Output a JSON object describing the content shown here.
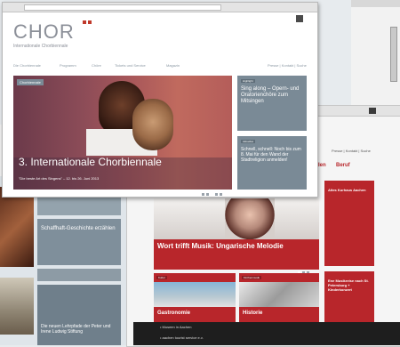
{
  "front_window": {
    "logo_text": "CHOR",
    "logo_subtitle": "Internationale Chorbiennale",
    "nav_items": [
      "Die Chorbiennale",
      "Programm",
      "Chöre",
      "Tickets und Service",
      "Magazin"
    ],
    "nav_right": "Presse | Kontakt | Suche",
    "hero_badge": "Chorbiennale",
    "hero_title": "3. Internationale Chorbiennale",
    "hero_subtitle": "\"Die beste Art des Singens\" – 12. bis 26. Juni 2013",
    "side_box_1": {
      "tag": "Highlight",
      "title": "Sing along – Opern- und Oratorienchöre zum Mitsingen"
    },
    "side_box_2": {
      "tag": "Aktuelles",
      "title": "Schnell, schnell: Noch bis zum 8. Mai für den Wand der Stadtreligion anmelden!"
    }
  },
  "right_window": {
    "top_links": "Presse | Kontakt | Suche",
    "nav_visible": [
      "den",
      "Beruf"
    ],
    "feature_title": "Wort trifft Musik: Ungarische Melodie",
    "tile_1_tag": "Kultur",
    "tile_1_title": "Gastronomie",
    "tile_2_tag": "Kirchenmusik",
    "tile_2_title": "Historie",
    "sidebar_box_1_title": "Altes Kurhaus Aachen",
    "sidebar_box_2_title": "Ene Musikreise nach St. Petersburg + Kinderkonzert"
  },
  "left_window": {
    "teaser_title": "Schaffhaft-Geschichte erzählen",
    "teaser_2_title": "Die neuen Lehrpfade der Peter und Irene Ludwig Stiftung"
  },
  "dark_bar": {
    "items": [
      "Museen in Aachen",
      "aachen tourist service e.v."
    ]
  },
  "colors": {
    "accent_red": "#b8262b",
    "slate": "#7a8a96",
    "logo_gray": "#8b8f98",
    "logo_accent": "#c0392b"
  }
}
